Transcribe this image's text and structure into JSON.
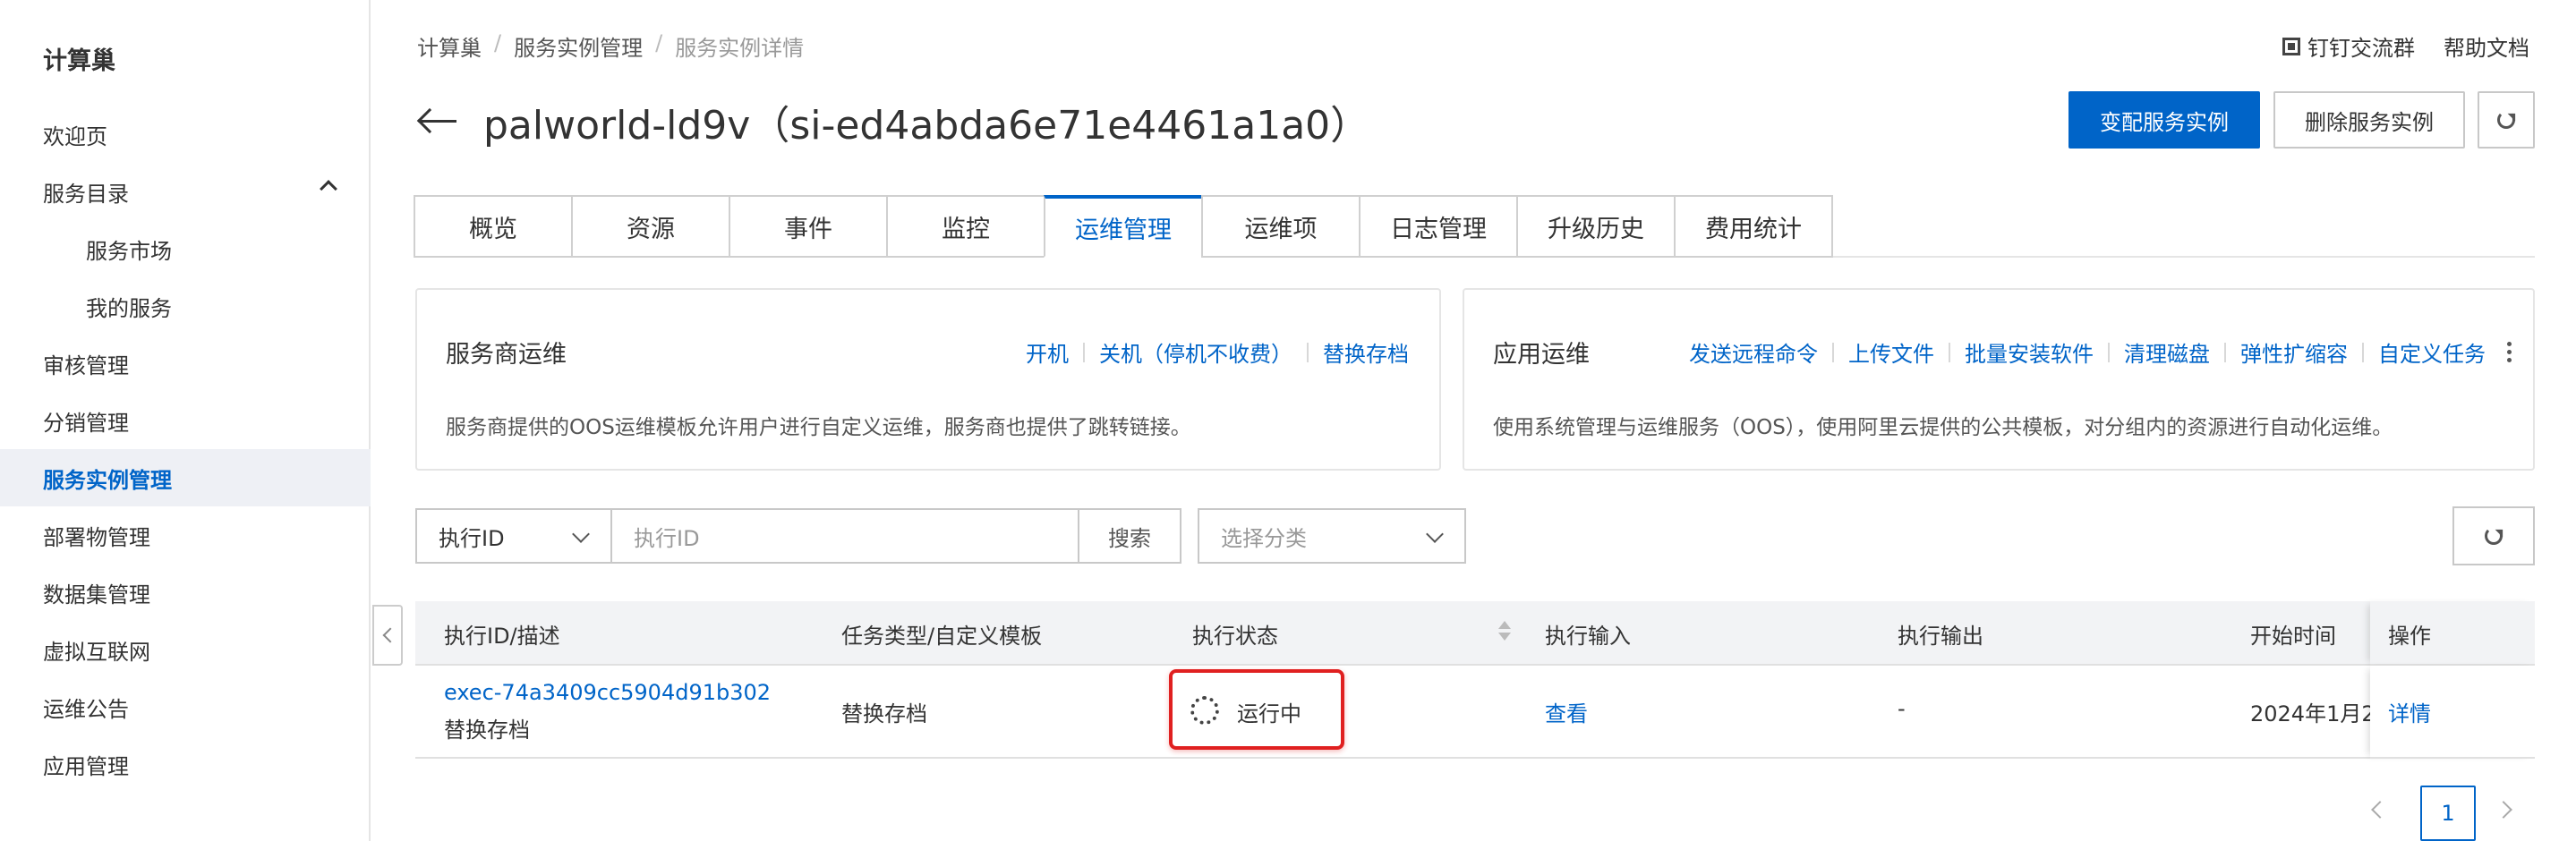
{
  "sidebar": {
    "title": "计算巢",
    "items": [
      {
        "label": "欢迎页"
      },
      {
        "label": "服务目录"
      },
      {
        "label": "服务市场"
      },
      {
        "label": "我的服务"
      },
      {
        "label": "审核管理"
      },
      {
        "label": "分销管理"
      },
      {
        "label": "服务实例管理"
      },
      {
        "label": "部署物管理"
      },
      {
        "label": "数据集管理"
      },
      {
        "label": "虚拟互联网"
      },
      {
        "label": "运维公告"
      },
      {
        "label": "应用管理"
      }
    ]
  },
  "breadcrumb": [
    "计算巢",
    "服务实例管理",
    "服务实例详情"
  ],
  "top_links": {
    "dingtalk": "钉钉交流群",
    "help": "帮助文档"
  },
  "page_title": "palworld-ld9v（si-ed4abda6e71e4461a1a0）",
  "buttons": {
    "change": "变配服务实例",
    "delete": "删除服务实例"
  },
  "tabs": [
    "概览",
    "资源",
    "事件",
    "监控",
    "运维管理",
    "运维项",
    "日志管理",
    "升级历史",
    "费用统计"
  ],
  "active_tab": "运维管理",
  "provider_ops": {
    "title": "服务商运维",
    "actions": [
      "开机",
      "关机（停机不收费）",
      "替换存档"
    ],
    "desc": "服务商提供的OOS运维模板允许用户进行自定义运维，服务商也提供了跳转链接。"
  },
  "app_ops": {
    "title": "应用运维",
    "actions": [
      "发送远程命令",
      "上传文件",
      "批量安装软件",
      "清理磁盘",
      "弹性扩缩容",
      "自定义任务"
    ],
    "desc": "使用系统管理与运维服务（OOS），使用阿里云提供的公共模板，对分组内的资源进行自动化运维。"
  },
  "search": {
    "field_select": "执行ID",
    "placeholder": "执行ID",
    "button": "搜索",
    "category_placeholder": "选择分类"
  },
  "table": {
    "headers": [
      "执行ID/描述",
      "任务类型/自定义模板",
      "执行状态",
      "执行输入",
      "执行输出",
      "开始时间",
      "操作"
    ],
    "rows": [
      {
        "exec_id": "exec-74a3409cc5904d91b302",
        "desc": "替换存档",
        "task_type": "替换存档",
        "status": "运行中",
        "input": "查看",
        "output": "-",
        "start_time": "2024年1月2",
        "action": "详情"
      }
    ]
  },
  "pagination": {
    "current": "1"
  },
  "colors": {
    "primary": "#0064c8",
    "highlight": "#e02020"
  }
}
